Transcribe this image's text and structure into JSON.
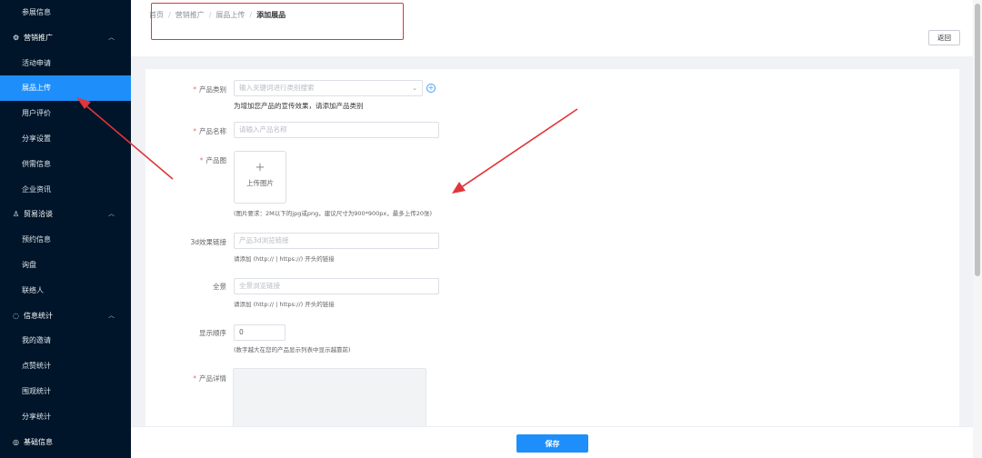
{
  "sidebar": {
    "items": [
      {
        "type": "item",
        "label": "参展信息"
      },
      {
        "type": "group",
        "label": "营销推广",
        "icon": "gear-icon",
        "expanded": true
      },
      {
        "type": "item",
        "label": "活动申请"
      },
      {
        "type": "item",
        "label": "展品上传",
        "active": true
      },
      {
        "type": "item",
        "label": "用户评价"
      },
      {
        "type": "item",
        "label": "分享设置"
      },
      {
        "type": "item",
        "label": "供需信息"
      },
      {
        "type": "item",
        "label": "企业资讯"
      },
      {
        "type": "group",
        "label": "贸易洽谈",
        "icon": "user-icon",
        "expanded": true
      },
      {
        "type": "item",
        "label": "预约信息"
      },
      {
        "type": "item",
        "label": "询盘"
      },
      {
        "type": "item",
        "label": "联络人"
      },
      {
        "type": "group",
        "label": "信息统计",
        "icon": "stats-icon",
        "expanded": true
      },
      {
        "type": "item",
        "label": "我的邀请"
      },
      {
        "type": "item",
        "label": "点赞统计"
      },
      {
        "type": "item",
        "label": "围观统计"
      },
      {
        "type": "item",
        "label": "分享统计"
      },
      {
        "type": "group",
        "label": "基础信息",
        "icon": "info-icon",
        "expanded": false
      }
    ]
  },
  "breadcrumb": {
    "items": [
      "首页",
      "营销推广",
      "展品上传",
      "添加展品"
    ]
  },
  "header": {
    "back_label": "返回"
  },
  "form": {
    "category": {
      "label": "产品类别",
      "placeholder": "输入关键词进行类别搜索",
      "hint": "为增加您产品的宣传效果，请添加产品类别"
    },
    "name": {
      "label": "产品名称",
      "placeholder": "请输入产品名称"
    },
    "image": {
      "label": "产品图",
      "upload_label": "上传图片",
      "hint": "(图片要求：2M以下的jpg或png，建议尺寸为900*900px，最多上传20张)"
    },
    "link3d": {
      "label": "3d效果链接",
      "placeholder": "产品3d浏览链接",
      "hint": "请添加 (http:// | https://) 开头的链接"
    },
    "panorama": {
      "label": "全景",
      "placeholder": "全景浏览链接",
      "hint": "请添加 (http:// | https://) 开头的链接"
    },
    "order": {
      "label": "显示顺序",
      "value": "0",
      "hint": "(数字越大在您的产品显示列表中显示越靠前)"
    },
    "detail": {
      "label": "产品详情"
    }
  },
  "footer": {
    "save_label": "保存"
  },
  "colors": {
    "sidebar_bg": "#001529",
    "accent": "#1e8ffa",
    "required": "#f56c6c",
    "annotation": "#e0363a"
  }
}
